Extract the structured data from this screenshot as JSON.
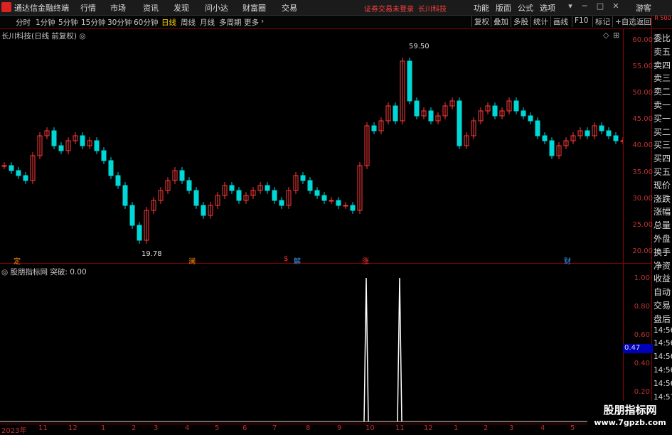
{
  "app": {
    "title": "通达信金融终端"
  },
  "menu": [
    "行情",
    "市场",
    "资讯",
    "发现",
    "问小达",
    "财富圈",
    "交易"
  ],
  "header_right": {
    "warning": "证券交易未登录",
    "stock_name": "长川科技",
    "items": [
      "功能",
      "版面",
      "公式",
      "选项"
    ],
    "guest": "游客"
  },
  "periods": [
    "分时",
    "1分钟",
    "5分钟",
    "15分钟",
    "30分钟",
    "60分钟",
    "日线",
    "周线",
    "月线",
    "多周期",
    "更多"
  ],
  "active_period": "日线",
  "tools": [
    "复权",
    "叠加",
    "多股",
    "统计",
    "画线",
    "F10",
    "标记",
    "+自选",
    "返回"
  ],
  "main_title": "长川科技(日线 前复权)",
  "price_axis": [
    "60.00",
    "55.00",
    "50.00",
    "45.00",
    "40.00",
    "35.00",
    "30.00",
    "25.00",
    "20.00"
  ],
  "high_label": "59.50",
  "low_label": "19.78",
  "right_panel": [
    "委比",
    "卖五",
    "卖四",
    "卖三",
    "卖二",
    "卖一",
    "买一",
    "买二",
    "买三",
    "买四",
    "买五",
    "现价",
    "涨跌",
    "涨幅",
    "总量",
    "外盘",
    "换手",
    "净资",
    "收益",
    "自动",
    "交易",
    "盘后",
    "14:56",
    "14:56",
    "14:56",
    "14:56",
    "14:56",
    "14:57",
    "14:57"
  ],
  "top_right_box": "R 500",
  "event_badges": [
    {
      "text": "定",
      "color": "#ff8c00"
    },
    {
      "text": "澜",
      "color": "#ff8c00"
    },
    {
      "text": "$",
      "color": "#ff3030"
    },
    {
      "text": "解",
      "color": "#3aa0ff"
    },
    {
      "text": "涨",
      "color": "#ff3030"
    },
    {
      "text": "财",
      "color": "#3aa0ff"
    }
  ],
  "indicator": {
    "title": "股朋指标网",
    "name": "突破",
    "value": "0.00",
    "current": "0.47",
    "axis": [
      "1.00",
      "0.80",
      "0.60",
      "0.40",
      "0.20"
    ]
  },
  "dates": [
    "2023年",
    "11",
    "12",
    "1",
    "2",
    "3",
    "4",
    "5",
    "6",
    "7",
    "8",
    "9",
    "10",
    "11",
    "12",
    "1",
    "2",
    "3",
    "4",
    "5"
  ],
  "watermark": {
    "title": "股朋指标网",
    "url": "www.7gpzb.com"
  },
  "chart_data": {
    "type": "candlestick",
    "ylim": [
      18,
      62
    ],
    "x": [
      0,
      10,
      20,
      30,
      40,
      50,
      60,
      70,
      80,
      90,
      100,
      110,
      120,
      130,
      140,
      150,
      160,
      170,
      180,
      190,
      200,
      210,
      220,
      230,
      240,
      250,
      260,
      270,
      280,
      290,
      300,
      310,
      320,
      330,
      340,
      350,
      360,
      370,
      380,
      390,
      400,
      410,
      420,
      430,
      440,
      450,
      460,
      470,
      480,
      490,
      500,
      510,
      520,
      530,
      540,
      550,
      560,
      570,
      580,
      590,
      600,
      610,
      620,
      630,
      640,
      650,
      660,
      670,
      680,
      690,
      700,
      710,
      720,
      730,
      740,
      750,
      760,
      770,
      780,
      790,
      800,
      810,
      820,
      830,
      840,
      850,
      860,
      870
    ],
    "close": [
      36,
      35,
      34,
      33,
      38,
      42,
      43,
      40,
      39,
      41,
      42,
      40,
      41,
      39,
      37,
      34,
      32,
      28,
      24,
      21,
      27,
      29,
      31,
      33,
      35,
      33,
      31,
      28,
      26,
      28,
      30,
      32,
      31,
      29,
      30,
      31,
      32,
      31,
      29,
      28,
      31,
      34,
      33,
      31,
      30,
      29,
      29,
      28,
      28,
      27,
      36,
      44,
      43,
      45,
      48,
      45,
      57,
      49,
      46,
      47,
      45,
      46,
      48,
      49,
      40,
      42,
      45,
      47,
      48,
      46,
      47,
      49,
      47,
      46,
      45,
      42,
      41,
      38,
      40,
      41,
      42,
      43,
      42,
      44,
      43,
      42,
      41,
      41
    ],
    "peaks": [
      {
        "x": 515,
        "value": 1.0
      },
      {
        "x": 562,
        "value": 1.0
      }
    ]
  }
}
